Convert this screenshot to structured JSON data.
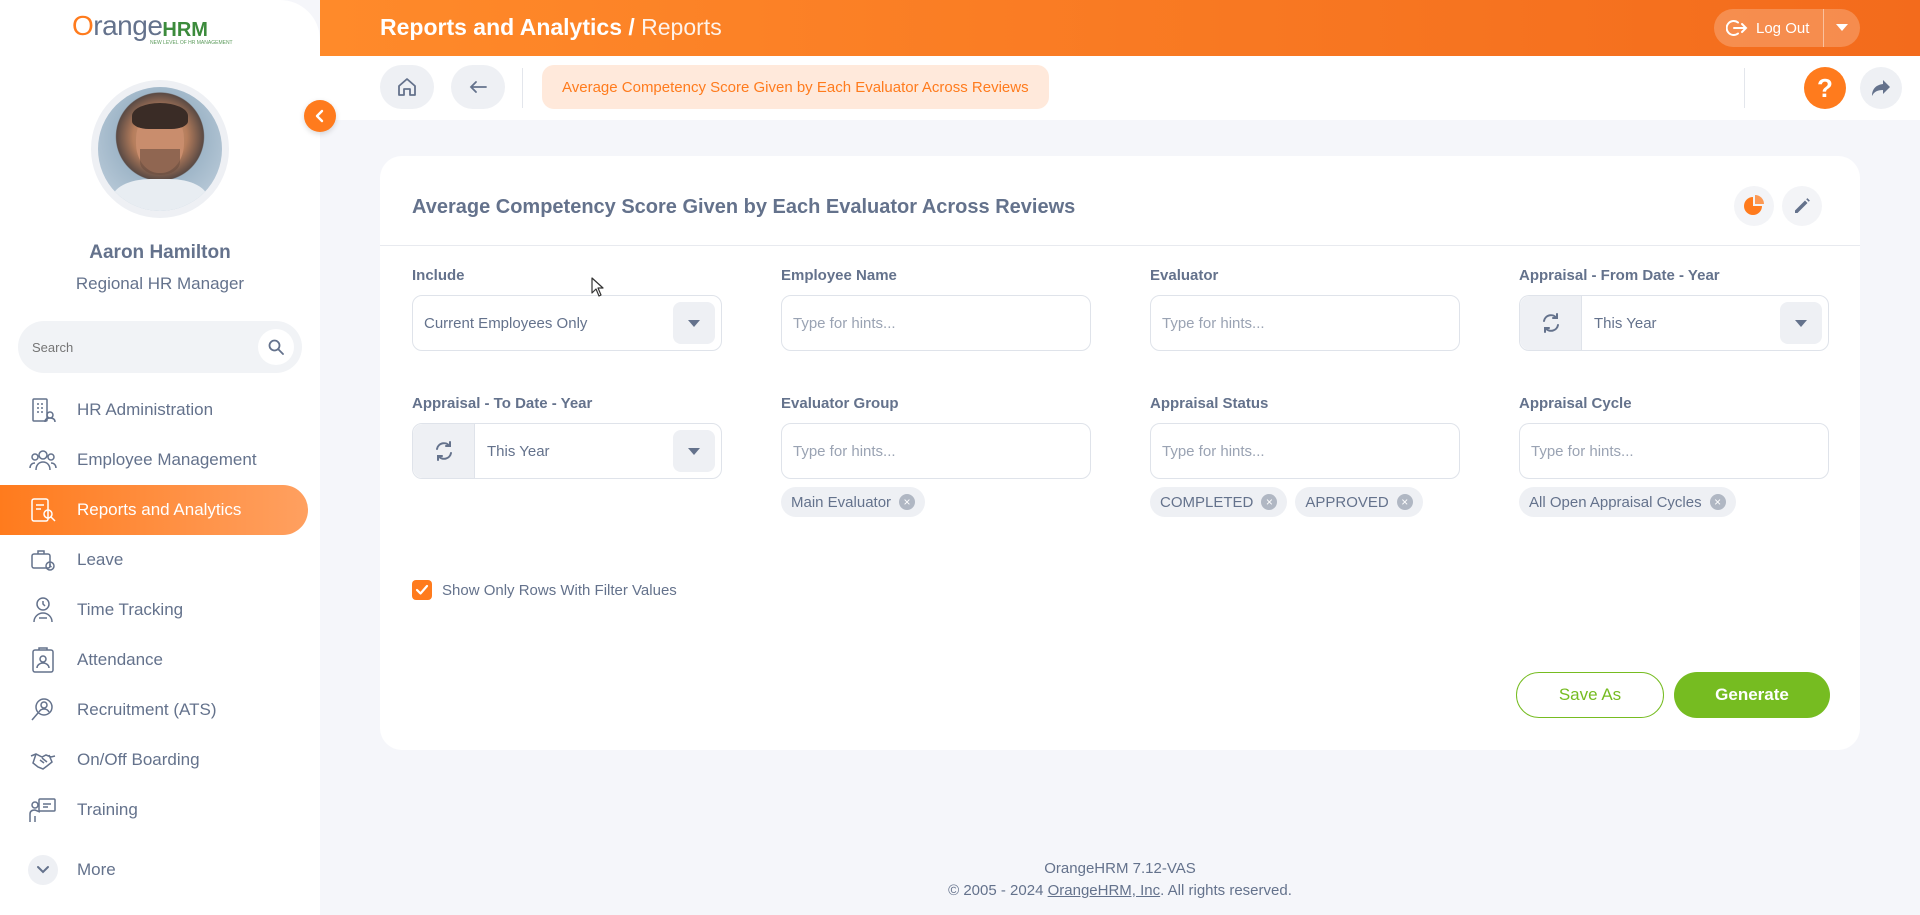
{
  "app": {
    "logo_main": "range",
    "logo_o": "O",
    "logo_hrm": "HRM",
    "logo_tagline": "NEW LEVEL OF HR MANAGEMENT"
  },
  "user": {
    "name": "Aaron Hamilton",
    "role": "Regional HR Manager"
  },
  "sidebar": {
    "search_placeholder": "Search",
    "items": [
      {
        "label": "HR Administration",
        "icon": "building-icon"
      },
      {
        "label": "Employee Management",
        "icon": "people-icon"
      },
      {
        "label": "Reports and Analytics",
        "icon": "report-icon",
        "active": true
      },
      {
        "label": "Leave",
        "icon": "suitcase-icon"
      },
      {
        "label": "Time Tracking",
        "icon": "clock-person-icon"
      },
      {
        "label": "Attendance",
        "icon": "clipboard-user-icon"
      },
      {
        "label": "Recruitment (ATS)",
        "icon": "recruit-icon"
      },
      {
        "label": "On/Off Boarding",
        "icon": "handshake-icon"
      },
      {
        "label": "Training",
        "icon": "presentation-icon"
      }
    ],
    "more_label": "More"
  },
  "header": {
    "title": "Reports and Analytics",
    "separator": " / ",
    "subtitle": "Reports",
    "logout_label": "Log Out"
  },
  "subbar": {
    "breadcrumb": "Average Competency Score Given by Each Evaluator Across Reviews",
    "help": "?"
  },
  "report": {
    "title": "Average Competency Score Given by Each Evaluator Across Reviews",
    "fields": {
      "include": {
        "label": "Include",
        "value": "Current Employees Only"
      },
      "employee_name": {
        "label": "Employee Name",
        "placeholder": "Type for hints..."
      },
      "evaluator": {
        "label": "Evaluator",
        "placeholder": "Type for hints..."
      },
      "from_year": {
        "label": "Appraisal - From Date - Year",
        "value": "This Year"
      },
      "to_year": {
        "label": "Appraisal - To Date - Year",
        "value": "This Year"
      },
      "evaluator_group": {
        "label": "Evaluator Group",
        "placeholder": "Type for hints...",
        "chips": [
          "Main Evaluator"
        ]
      },
      "appraisal_status": {
        "label": "Appraisal Status",
        "placeholder": "Type for hints...",
        "chips": [
          "COMPLETED",
          "APPROVED"
        ]
      },
      "appraisal_cycle": {
        "label": "Appraisal Cycle",
        "placeholder": "Type for hints...",
        "chips": [
          "All Open Appraisal Cycles"
        ]
      }
    },
    "checkbox_label": "Show Only Rows With Filter Values",
    "checkbox_checked": true,
    "save_as_label": "Save As",
    "generate_label": "Generate"
  },
  "footer": {
    "version": "OrangeHRM 7.12-VAS",
    "copyright_prefix": "© 2005 - 2024 ",
    "company_link": "OrangeHRM, Inc",
    "copyright_suffix": ". All rights reserved."
  },
  "colors": {
    "accent": "#ff7b1d",
    "green": "#76bc21",
    "text": "#64728c"
  }
}
